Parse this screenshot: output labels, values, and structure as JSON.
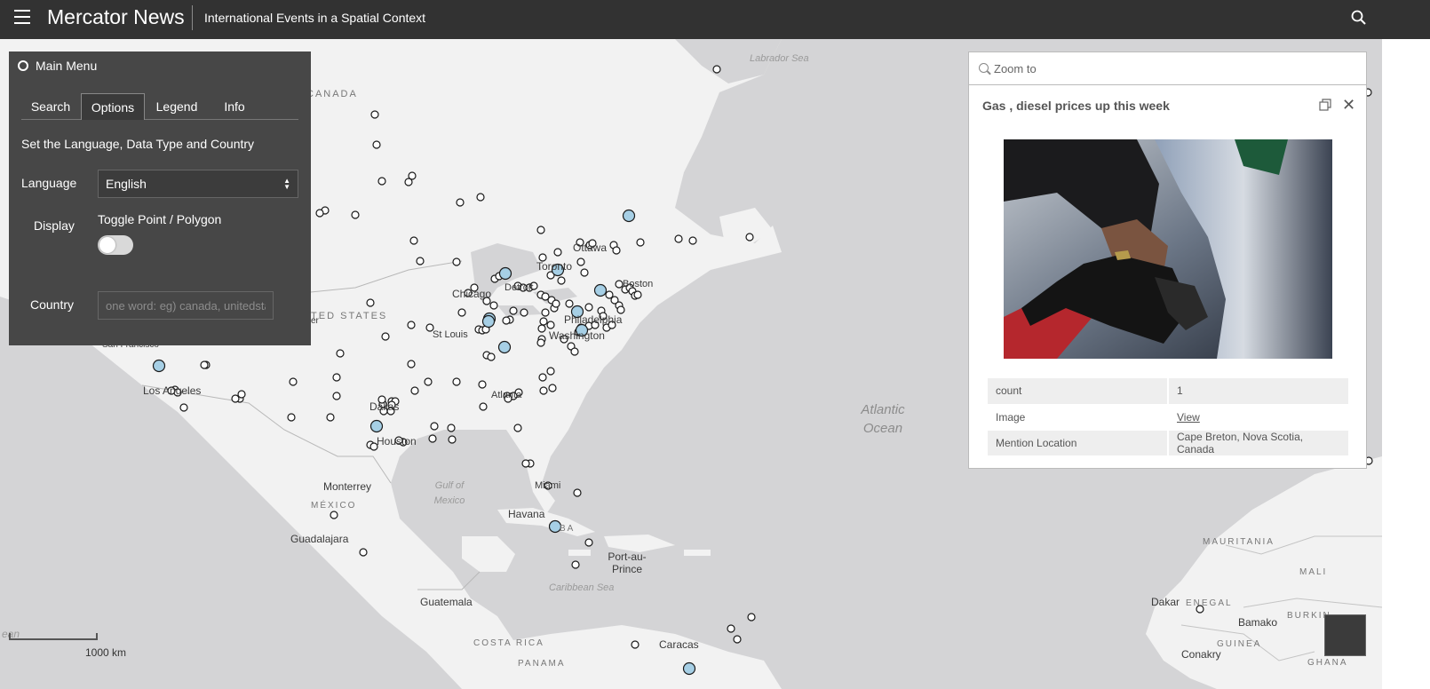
{
  "header": {
    "title": "Mercator News",
    "subtitle": "International Events in a Spatial Context"
  },
  "menu": {
    "title": "Main Menu",
    "tabs": [
      {
        "label": "Search",
        "active": false
      },
      {
        "label": "Options",
        "active": true
      },
      {
        "label": "Legend",
        "active": false
      },
      {
        "label": "Info",
        "active": false
      }
    ],
    "description": "Set the Language, Data Type and Country",
    "language_label": "Language",
    "language_value": "English",
    "display_label": "Display",
    "toggle_label": "Toggle Point / Polygon",
    "toggle_on": false,
    "country_label": "Country",
    "country_placeholder": "one word: eg) canada, unitedstates"
  },
  "popup": {
    "zoom_label": "Zoom to",
    "title": "Gas , diesel prices up this week",
    "attributes": [
      {
        "key": "count",
        "value": "1"
      },
      {
        "key": "Image",
        "value": "View"
      },
      {
        "key": "Mention Location",
        "value": "Cape Breton, Nova Scotia, Canada"
      }
    ]
  },
  "map": {
    "scale_label": "1000 km",
    "regions": [
      "CANADA",
      "UNITED STATES",
      "MÉXICO",
      "CUBA",
      "MAURITANIA",
      "MALI",
      "SENEGAL",
      "GUINEA",
      "BURKINA",
      "GHANA",
      "COSTA RICA",
      "PANAMA"
    ],
    "cities": [
      "Ottawa",
      "Toronto",
      "Boston",
      "Detroit",
      "Chicago",
      "Philadelphia",
      "Washington",
      "St Louis",
      "Atlanta",
      "Dallas",
      "Houston",
      "Miami",
      "Havana",
      "Los Angeles",
      "San Francisco",
      "Monterrey",
      "Guadalajara",
      "Guatemala",
      "Port-au-Prince",
      "Caracas",
      "Dakar",
      "Bamako",
      "Conakry",
      "Denver"
    ],
    "water_labels": [
      "Labrador Sea",
      "Gulf of Mexico",
      "Caribbean Sea",
      "Atlantic Ocean",
      "Ocean"
    ]
  },
  "colors": {
    "topbar": "#323232",
    "panel": "#474747",
    "map_land": "#f2f2f2",
    "map_water": "#d4d4d6",
    "marker_large": "#a6cfe5"
  }
}
